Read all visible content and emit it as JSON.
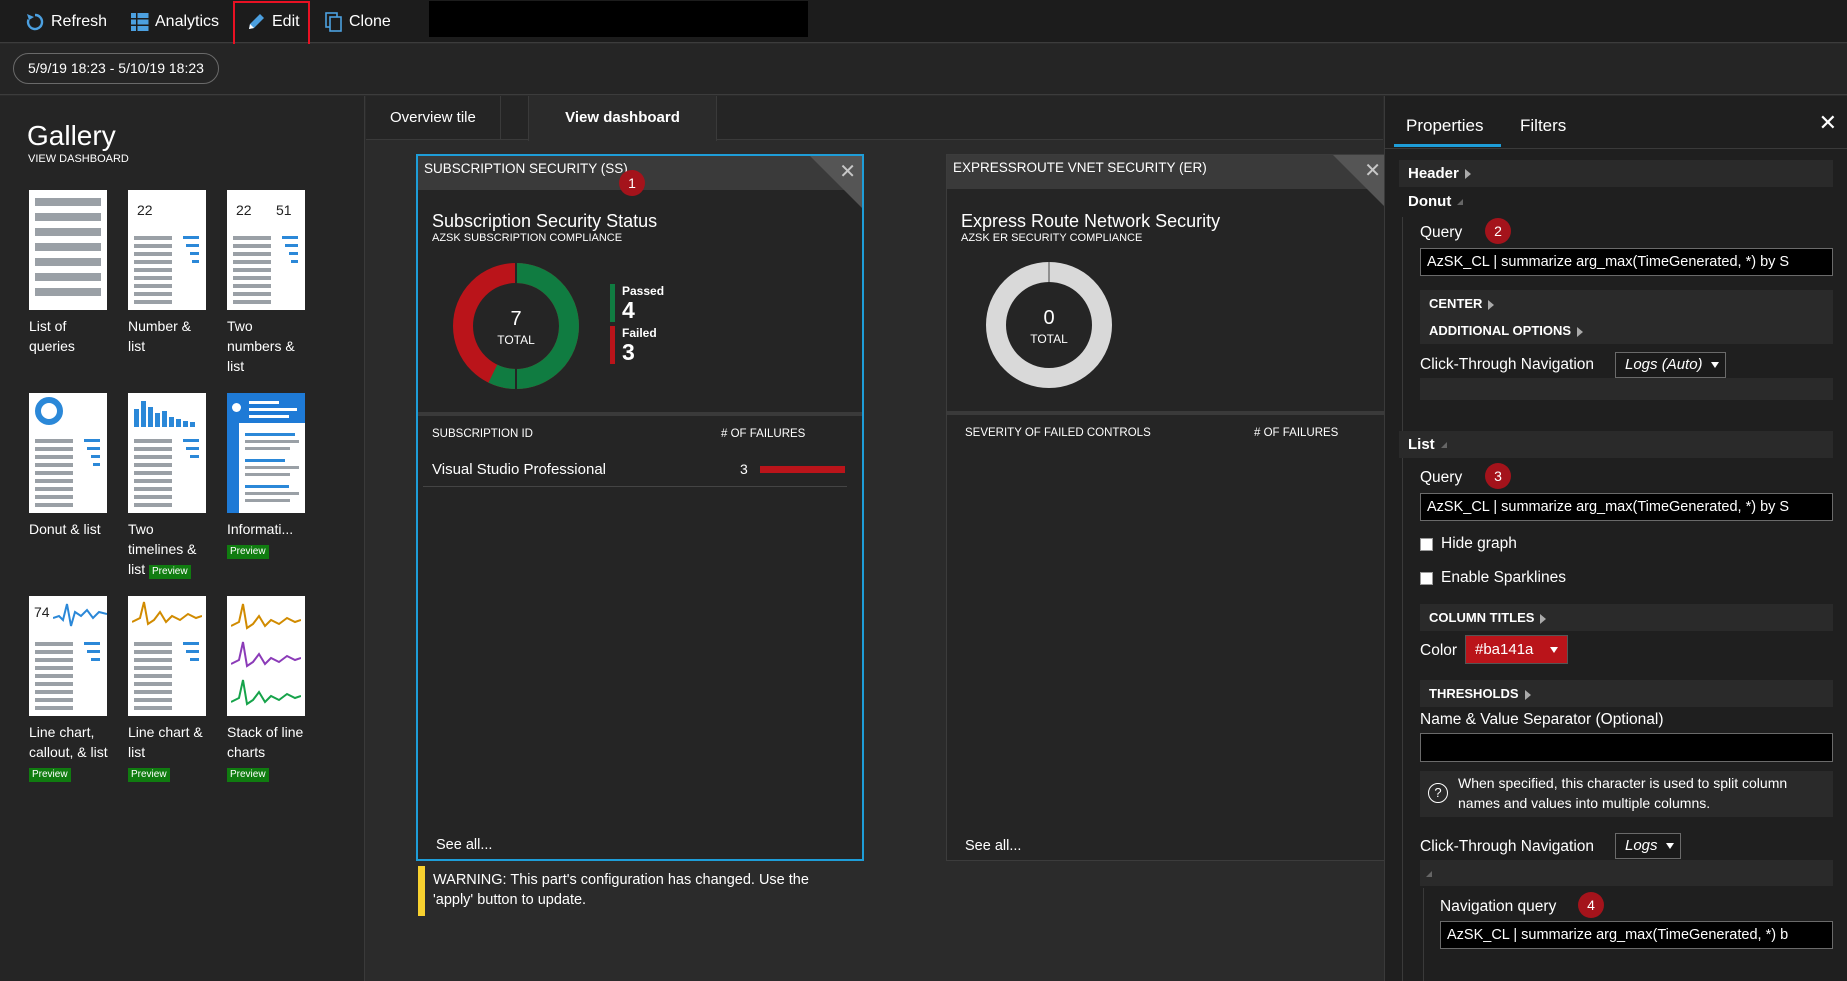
{
  "toolbar": {
    "refresh": "Refresh",
    "analytics": "Analytics",
    "edit": "Edit",
    "clone": "Clone"
  },
  "time_range": "5/9/19 18:23 - 5/10/19 18:23",
  "gallery": {
    "title": "Gallery",
    "subtitle": "VIEW DASHBOARD",
    "preview_badge": "Preview",
    "items": [
      {
        "label": "List of queries"
      },
      {
        "label": "Number & list",
        "num1": "22"
      },
      {
        "label": "Two numbers & list",
        "num1": "22",
        "num2": "51"
      },
      {
        "label": "Donut & list"
      },
      {
        "label": "Two timelines & list",
        "preview": true
      },
      {
        "label": "Informati...",
        "preview": true
      },
      {
        "label": "Line chart, callout, & list",
        "num1": "74",
        "preview": true
      },
      {
        "label": "Line chart & list",
        "preview": true
      },
      {
        "label": "Stack of line charts",
        "preview": true
      }
    ]
  },
  "tabs": {
    "overview": "Overview tile",
    "view_dashboard": "View dashboard"
  },
  "tile1": {
    "header": "SUBSCRIPTION SECURITY (SS)",
    "title": "Subscription Security Status",
    "subtitle": "AZSK SUBSCRIPTION COMPLIANCE",
    "total_value": "7",
    "total_label": "TOTAL",
    "passed_label": "Passed",
    "passed_value": "4",
    "failed_label": "Failed",
    "failed_value": "3",
    "col1": "SUBSCRIPTION ID",
    "col2": "# OF FAILURES",
    "row_name": "Visual Studio Professional",
    "row_value": "3",
    "see_all": "See all...",
    "badge": "1"
  },
  "tile2": {
    "header": "EXPRESSROUTE VNET SECURITY (ER)",
    "title": "Express Route Network Security",
    "subtitle": "AZSK ER SECURITY COMPLIANCE",
    "total_value": "0",
    "total_label": "TOTAL",
    "col1": "SEVERITY OF FAILED CONTROLS",
    "col2": "# OF FAILURES",
    "see_all": "See all..."
  },
  "warning": "WARNING: This part's configuration has changed. Use the 'apply' button to update.",
  "properties": {
    "tab_properties": "Properties",
    "tab_filters": "Filters",
    "header_section": "Header",
    "donut_section": "Donut",
    "query_label": "Query",
    "donut_query": "AzSK_CL  | summarize arg_max(TimeGenerated, *) by S",
    "center": "CENTER",
    "additional_options": "ADDITIONAL OPTIONS",
    "click_through": "Click-Through Navigation",
    "logs_auto": "Logs (Auto)",
    "list_section": "List",
    "list_query": "AzSK_CL  | summarize arg_max(TimeGenerated, *) by S",
    "hide_graph": "Hide graph",
    "enable_sparklines": "Enable Sparklines",
    "column_titles": "COLUMN TITLES",
    "color_label": "Color",
    "color_value": "#ba141a",
    "thresholds": "THRESHOLDS",
    "separator_label": "Name & Value Separator (Optional)",
    "separator_value": "",
    "info_text": "When specified, this character is used to split column names and values into multiple columns.",
    "logs": "Logs",
    "navigation_query_label": "Navigation query",
    "navigation_query": "AzSK_CL  | summarize arg_max(TimeGenerated, *) b",
    "badge2": "2",
    "badge3": "3",
    "badge4": "4"
  },
  "colors": {
    "passed": "#107c41",
    "failed": "#ba141a",
    "accent": "#1e9dd8",
    "warning": "#f8d12f"
  }
}
